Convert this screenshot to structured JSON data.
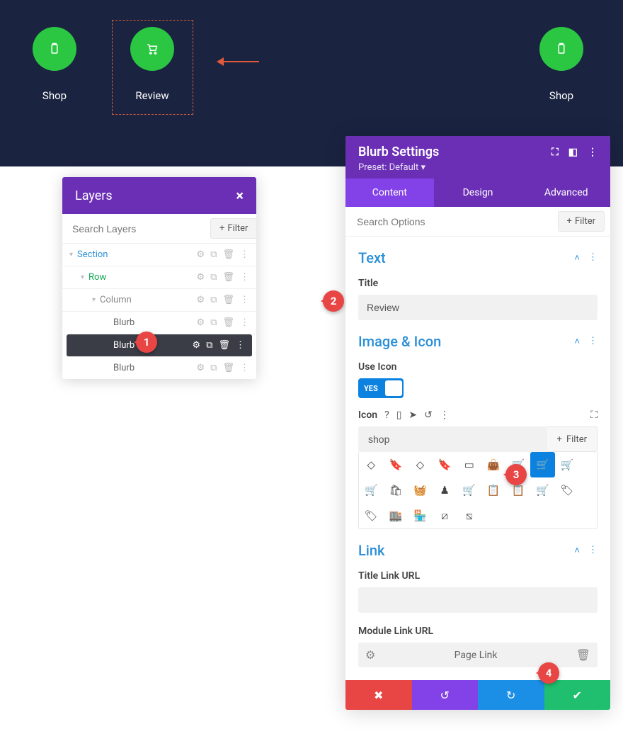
{
  "top": {
    "items": [
      {
        "label": "Shop",
        "icon": "clipboard"
      },
      {
        "label": "Review",
        "icon": "cart"
      },
      {
        "label": "Shop",
        "icon": "clipboard"
      }
    ]
  },
  "layers": {
    "title": "Layers",
    "search_placeholder": "Search Layers",
    "filter_label": "Filter",
    "tree": {
      "section": "Section",
      "row": "Row",
      "column": "Column",
      "blurbs": [
        "Blurb",
        "Blurb",
        "Blurb"
      ]
    }
  },
  "settings": {
    "title": "Blurb Settings",
    "preset": "Preset: Default",
    "tabs": {
      "content": "Content",
      "design": "Design",
      "advanced": "Advanced"
    },
    "search_placeholder": "Search Options",
    "filter_label": "Filter",
    "sections": {
      "text": {
        "heading": "Text",
        "title_label": "Title",
        "title_value": "Review"
      },
      "image_icon": {
        "heading": "Image & Icon",
        "use_icon_label": "Use Icon",
        "toggle_text": "YES",
        "icon_label": "Icon",
        "icon_search_value": "shop",
        "icon_filter_label": "Filter"
      },
      "link": {
        "heading": "Link",
        "title_url_label": "Title Link URL",
        "title_url_value": "",
        "module_url_label": "Module Link URL",
        "module_url_value": "Page Link"
      }
    }
  },
  "badges": [
    "1",
    "2",
    "3",
    "4"
  ],
  "colors": {
    "accent": "#6b2fb6",
    "green": "#2bc743",
    "blue": "#0b82e0",
    "red": "#e84545"
  }
}
